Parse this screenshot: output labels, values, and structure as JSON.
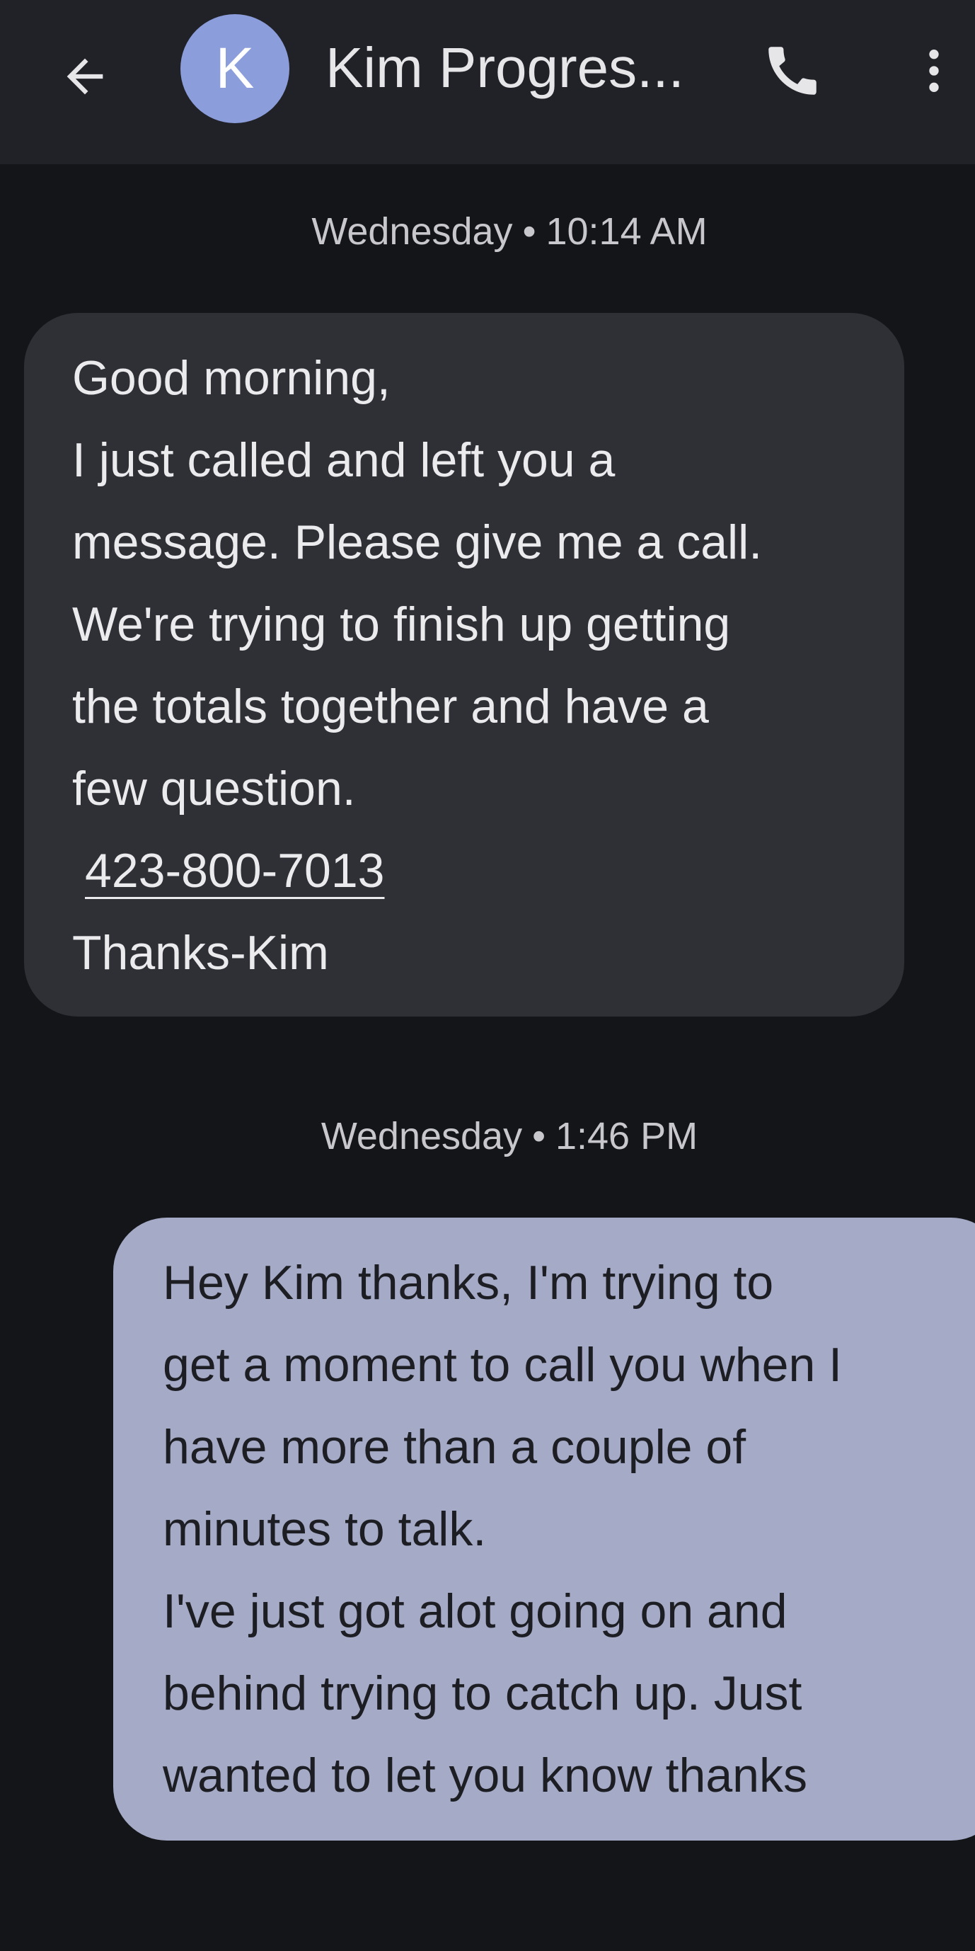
{
  "header": {
    "back_icon": "arrow-back-icon",
    "avatar_letter": "K",
    "avatar_color": "#8b9ddb",
    "contact_name": "Kim Progres...",
    "call_icon": "phone-icon",
    "more_icon": "more-vert-icon"
  },
  "messages": [
    {
      "timestamp_day": "Wednesday",
      "timestamp_separator": "•",
      "timestamp_time": "10:14 AM",
      "direction": "incoming",
      "lines": [
        "Good morning,",
        "I just called and left you a",
        "message. Please give me a call.",
        "We're trying to finish up getting",
        "the totals together and have a",
        "few question."
      ],
      "phone_link": "423-800-7013",
      "signoff": "Thanks-Kim"
    },
    {
      "timestamp_day": "Wednesday",
      "timestamp_separator": "•",
      "timestamp_time": "1:46 PM",
      "direction": "outgoing",
      "lines": [
        "Hey Kim thanks, I'm trying to",
        "get a moment to call you when I",
        "have more than a couple of",
        "minutes to talk.",
        "I've just got alot going on and",
        "behind trying to catch up. Just",
        "wanted to let you know thanks"
      ]
    }
  ],
  "colors": {
    "background": "#141519",
    "app_bar": "#212227",
    "incoming_bubble": "#2f3036",
    "outgoing_bubble": "#a5abc6"
  }
}
